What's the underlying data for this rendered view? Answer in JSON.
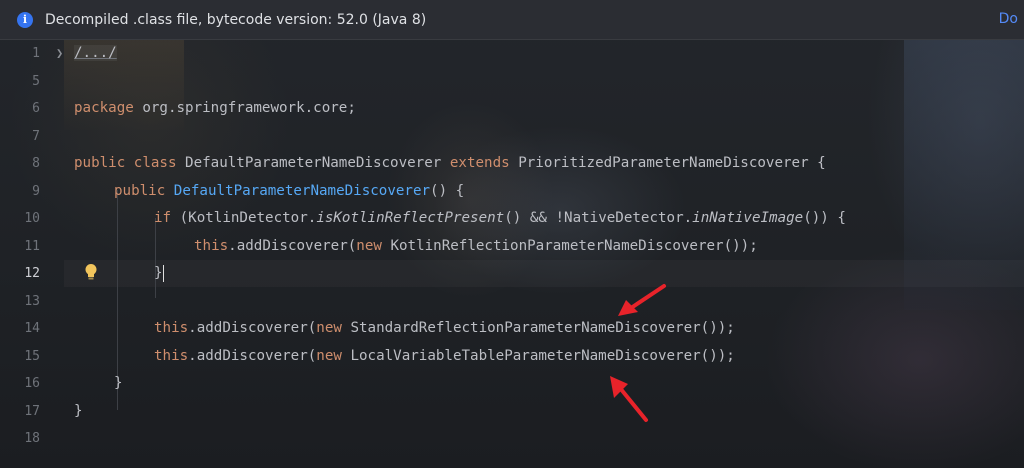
{
  "notice": {
    "icon": "info-icon",
    "icon_glyph": "i",
    "text": "Decompiled .class file, bytecode version: 52.0 (Java 8)",
    "link": "Do"
  },
  "gutter": {
    "line_numbers": [
      "1",
      "5",
      "6",
      "7",
      "8",
      "9",
      "10",
      "11",
      "12",
      "13",
      "14",
      "15",
      "16",
      "17",
      "18"
    ],
    "active_line": "12"
  },
  "code": {
    "l1_folded": "/.../",
    "l6_kw": "package",
    "l6_rest": " org.springframework.core;",
    "l8_kw1": "public",
    "l8_kw2": "class",
    "l8_name": " DefaultParameterNameDiscoverer ",
    "l8_kw3": "extends",
    "l8_rest": " PrioritizedParameterNameDiscoverer {",
    "l9_kw": "public",
    "l9_fn": "DefaultParameterNameDiscoverer",
    "l9_rest": "() {",
    "l10_kw": "if",
    "l10_a": " (KotlinDetector.",
    "l10_m1": "isKotlinReflectPresent",
    "l10_b": "() && !NativeDetector.",
    "l10_m2": "inNativeImage",
    "l10_c": "()) {",
    "l11_kw1": "this",
    "l11_a": ".addDiscoverer(",
    "l11_kw2": "new",
    "l11_b": " KotlinReflectionParameterNameDiscoverer());",
    "l12_brace": "}",
    "l14_kw1": "this",
    "l14_a": ".addDiscoverer(",
    "l14_kw2": "new",
    "l14_b": " StandardReflectionParameterNameDiscoverer());",
    "l15_kw1": "this",
    "l15_a": ".addDiscoverer(",
    "l15_kw2": "new",
    "l15_b": " LocalVariableTableParameterNameDiscoverer());",
    "l16": "}",
    "l17": "}"
  },
  "colors": {
    "keyword": "#cf8e6d",
    "method": "#56a8f5",
    "text": "#bcbec4",
    "annotation_arrow": "#e8232a"
  }
}
